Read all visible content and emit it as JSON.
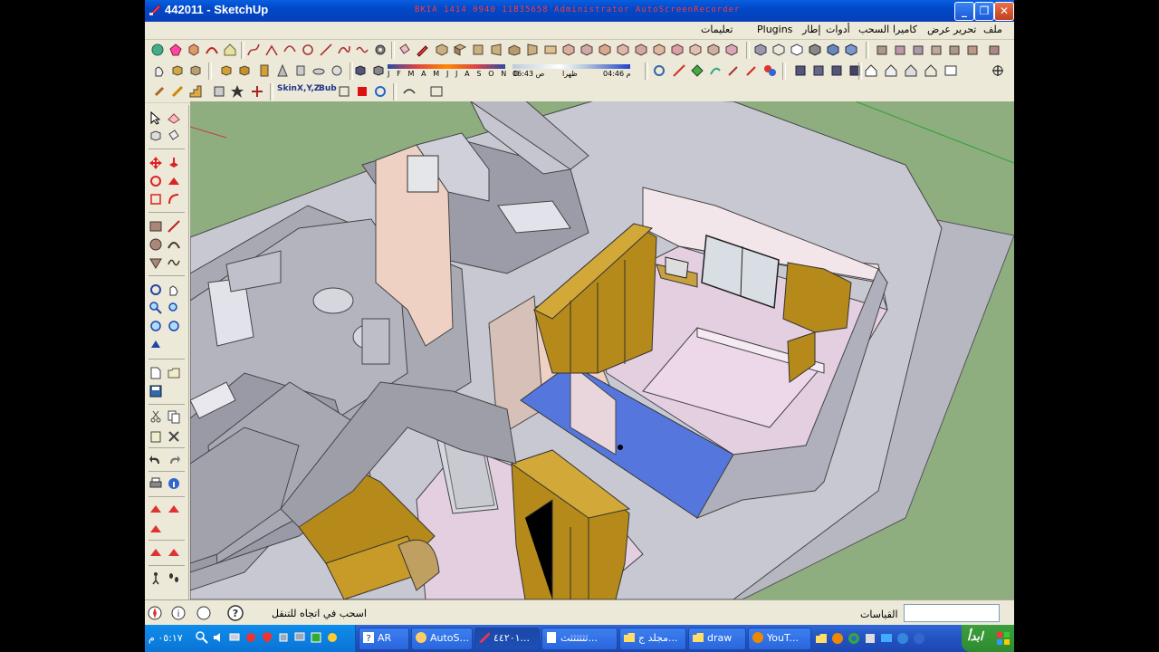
{
  "window": {
    "title": "442011 - SketchUp",
    "watermark": "BKIA 1414 0940 11B35658 Administrator AutoScreenRecorder"
  },
  "menu": {
    "items": [
      "ملف",
      "تحرير",
      "عرض",
      "كاميرا",
      "السحب",
      "أدوات",
      "إطار",
      "Plugins",
      "تعليمات"
    ]
  },
  "shadow_toolbar": {
    "months": "J F M A M J J A S O N D",
    "time_start": "06:43 ص",
    "time_noon": "ظهرا",
    "time_end": "04:46 م"
  },
  "plugin_toolbar": {
    "skin_label": "Skin",
    "xyz_label": "X,Y,Z",
    "bub_label": "Bub"
  },
  "status": {
    "hint": "اسحب في اتجاه للتنقل",
    "measurements_label": "القياسات",
    "measurements_value": ""
  },
  "taskbar": {
    "clock": "٠٥:١٧ م",
    "start_label": "ابدأ",
    "tasks": [
      "AR",
      "AutoS...",
      "٤٤٢٠١...",
      "ثثثثثثث...",
      "مجلد ج...",
      "draw",
      "YouT..."
    ]
  },
  "colors": {
    "ground": "#8fae80",
    "wall_top": "#c8c8d2",
    "wall_side": "#9a9aa6",
    "wall_face": "#b3b3be",
    "floor": "#dcdce4",
    "pink_floor": "#e3cfe0",
    "blue_floor": "#5577dd",
    "wardrobe": "#b58a1a",
    "peach_wall": "#efd1c4"
  }
}
